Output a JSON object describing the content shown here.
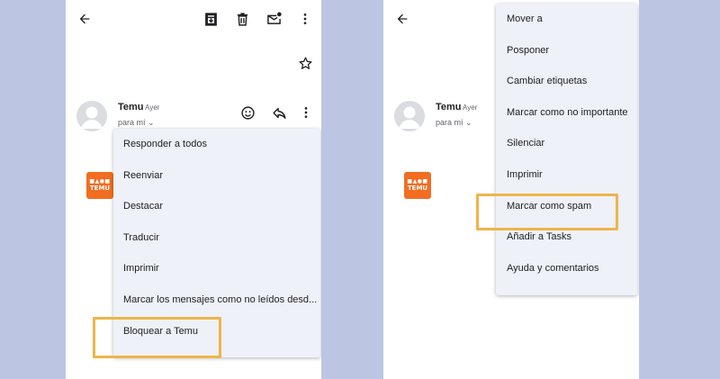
{
  "left_screen": {
    "sender": {
      "name": "Temu",
      "time": "Ayer",
      "recipient": "para mí"
    },
    "logo_text": "TEMU",
    "menu": [
      "Responder a todos",
      "Reenviar",
      "Destacar",
      "Traducir",
      "Imprimir",
      "Marcar los mensajes como no leídos desd...",
      "Bloquear a Temu"
    ]
  },
  "right_screen": {
    "sender": {
      "name": "Temu",
      "time": "Ayer",
      "recipient": "para mí"
    },
    "logo_text": "TEMU",
    "menu": [
      "Mover a",
      "Posponer",
      "Cambiar etiquetas",
      "Marcar como no importante",
      "Silenciar",
      "Imprimir",
      "Marcar como spam",
      "Añadir a Tasks",
      "Ayuda y comentarios"
    ]
  },
  "highlights": {
    "left": "Bloquear a Temu",
    "right": "Marcar como spam"
  },
  "colors": {
    "background": "#bcc6e3",
    "highlight": "#eeb54a",
    "menu_bg": "#eff1f8",
    "temu": "#f26d21"
  }
}
